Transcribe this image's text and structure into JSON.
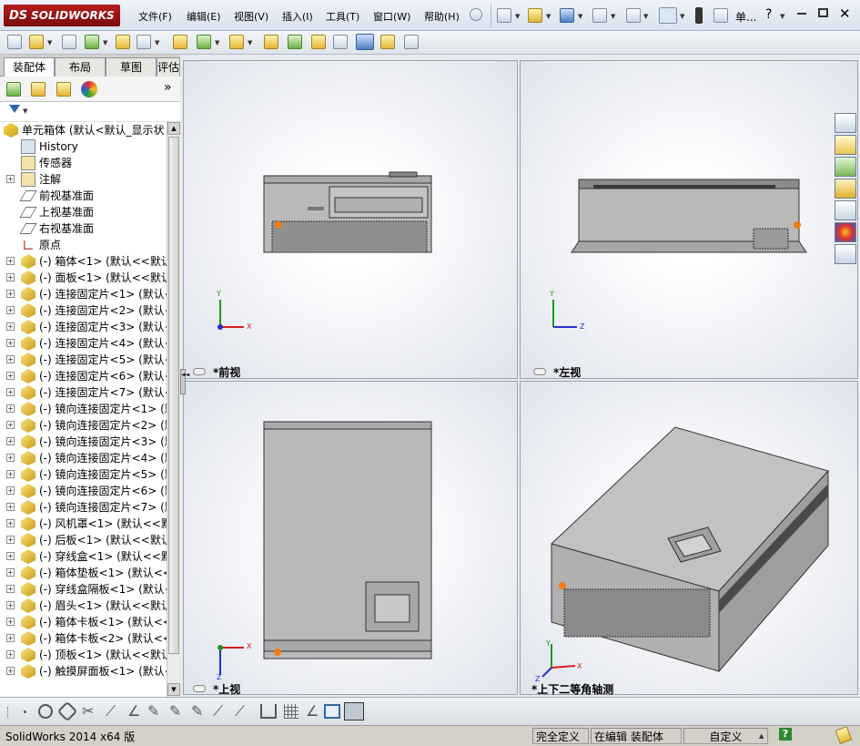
{
  "app": {
    "logo_text": "SOLIDWORKS",
    "logo_prefix": "DS"
  },
  "menu": {
    "items": [
      "文件(F)",
      "编辑(E)",
      "视图(V)",
      "插入(I)",
      "工具(T)",
      "窗口(W)",
      "帮助(H)"
    ],
    "search_label": "单...",
    "help_label": "?"
  },
  "left_panel": {
    "tabs": [
      "装配体",
      "布局",
      "草图",
      "评估"
    ],
    "active_tab": "装配体",
    "expand_arrow": "»"
  },
  "tree": {
    "root": "单元箱体 (默认<默认_显示状",
    "items": [
      {
        "label": "History",
        "expandable": false,
        "icon": "history-icon"
      },
      {
        "label": "传感器",
        "expandable": false,
        "icon": "sensor-icon"
      },
      {
        "label": "注解",
        "expandable": true,
        "icon": "annotation-icon"
      },
      {
        "label": "前视基准面",
        "expandable": false,
        "icon": "plane-icon"
      },
      {
        "label": "上视基准面",
        "expandable": false,
        "icon": "plane-icon"
      },
      {
        "label": "右视基准面",
        "expandable": false,
        "icon": "plane-icon"
      },
      {
        "label": "原点",
        "expandable": false,
        "icon": "origin-icon"
      },
      {
        "label": "(-) 箱体<1> (默认<<默认",
        "expandable": true,
        "icon": "part-icon"
      },
      {
        "label": "(-) 面板<1> (默认<<默认",
        "expandable": true,
        "icon": "part-icon"
      },
      {
        "label": "(-) 连接固定片<1> (默认<<",
        "expandable": true,
        "icon": "part-icon"
      },
      {
        "label": "(-) 连接固定片<2> (默认<<",
        "expandable": true,
        "icon": "part-icon"
      },
      {
        "label": "(-) 连接固定片<3> (默认<<",
        "expandable": true,
        "icon": "part-icon"
      },
      {
        "label": "(-) 连接固定片<4> (默认<<",
        "expandable": true,
        "icon": "part-icon"
      },
      {
        "label": "(-) 连接固定片<5> (默认<<",
        "expandable": true,
        "icon": "part-icon"
      },
      {
        "label": "(-) 连接固定片<6> (默认<<",
        "expandable": true,
        "icon": "part-icon"
      },
      {
        "label": "(-) 连接固定片<7> (默认<<",
        "expandable": true,
        "icon": "part-icon"
      },
      {
        "label": "(-) 镜向连接固定片<1> (默",
        "expandable": true,
        "icon": "part-icon"
      },
      {
        "label": "(-) 镜向连接固定片<2> (默",
        "expandable": true,
        "icon": "part-icon"
      },
      {
        "label": "(-) 镜向连接固定片<3> (默",
        "expandable": true,
        "icon": "part-icon"
      },
      {
        "label": "(-) 镜向连接固定片<4> (默",
        "expandable": true,
        "icon": "part-icon"
      },
      {
        "label": "(-) 镜向连接固定片<5> (默",
        "expandable": true,
        "icon": "part-icon"
      },
      {
        "label": "(-) 镜向连接固定片<6> (默",
        "expandable": true,
        "icon": "part-icon"
      },
      {
        "label": "(-) 镜向连接固定片<7> (默",
        "expandable": true,
        "icon": "part-icon"
      },
      {
        "label": "(-) 风机罩<1> (默认<<默认",
        "expandable": true,
        "icon": "part-icon"
      },
      {
        "label": "(-) 后板<1> (默认<<默认>",
        "expandable": true,
        "icon": "part-icon"
      },
      {
        "label": "(-) 穿线盒<1> (默认<<默认",
        "expandable": true,
        "icon": "part-icon"
      },
      {
        "label": "(-) 箱体垫板<1> (默认<<默",
        "expandable": true,
        "icon": "part-icon"
      },
      {
        "label": "(-) 穿线盒隔板<1> (默认<<",
        "expandable": true,
        "icon": "part-icon"
      },
      {
        "label": "(-) 眉头<1> (默认<<默认>",
        "expandable": true,
        "icon": "part-icon"
      },
      {
        "label": "(-) 箱体卡板<1> (默认<<默",
        "expandable": true,
        "icon": "part-icon"
      },
      {
        "label": "(-) 箱体卡板<2> (默认<<默",
        "expandable": true,
        "icon": "part-icon"
      },
      {
        "label": "(-) 顶板<1> (默认<<默认>",
        "expandable": true,
        "icon": "part-icon"
      },
      {
        "label": "(-) 触摸屏面板<1> (默认<<",
        "expandable": true,
        "icon": "part-icon"
      }
    ]
  },
  "viewports": [
    {
      "name": "*前视",
      "axes": [
        "Y",
        "X"
      ]
    },
    {
      "name": "*左视",
      "axes": [
        "Y",
        "Z"
      ]
    },
    {
      "name": "*上视",
      "axes": [
        "Z",
        "X"
      ]
    },
    {
      "name": "*上下二等角轴测",
      "axes": [
        "Y",
        "X",
        "Z"
      ]
    }
  ],
  "status": {
    "product": "SolidWorks 2014 x64 版",
    "definition": "完全定义",
    "editing": "在编辑 装配体",
    "units": "自定义",
    "help": "?"
  },
  "colors": {
    "logo_red": "#9b1515",
    "model_gray": "#b8b8b8",
    "axis_x": "#d42020",
    "axis_y": "#1a9a1a",
    "axis_z": "#2030d0",
    "origin_orange": "#f07d10"
  }
}
